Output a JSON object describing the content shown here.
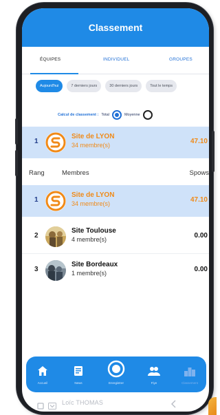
{
  "header": {
    "title": "Classement"
  },
  "tabs": [
    {
      "label": "ÉQUIPES"
    },
    {
      "label": "INDIVIDUEL"
    },
    {
      "label": "GROUPES"
    }
  ],
  "periods": [
    {
      "label": "Aujourd'hui",
      "active": true
    },
    {
      "label": "7 derniers jours",
      "active": false
    },
    {
      "label": "30 derniers jours",
      "active": false
    },
    {
      "label": "Tout le temps",
      "active": false
    }
  ],
  "calc": {
    "label": "Calcul de classement :",
    "option_total": "Total",
    "option_average": "Moyenne",
    "selected": "Total"
  },
  "my_team": {
    "rank": "1",
    "name": "Site de LYON",
    "members": "34 membre(s)",
    "score": "47.10"
  },
  "columns": {
    "rank": "Rang",
    "members": "Membres",
    "score": "Spows"
  },
  "rows": [
    {
      "rank": "1",
      "name": "Site de LYON",
      "members": "34 membre(s)",
      "score": "47.10"
    },
    {
      "rank": "2",
      "name": "Site Toulouse",
      "members": "4 membre(s)",
      "score": "0.00"
    },
    {
      "rank": "3",
      "name": "Site Bordeaux",
      "members": "1 membre(s)",
      "score": "0.00"
    }
  ],
  "nav": [
    {
      "label": "Accueil",
      "icon": "home-icon"
    },
    {
      "label": "News",
      "icon": "news-icon"
    },
    {
      "label": "Enregistrer",
      "icon": "record-icon"
    },
    {
      "label": "Fiye",
      "icon": "users-icon"
    },
    {
      "label": "Classement",
      "icon": "ranking-icon"
    }
  ],
  "android_bar": {
    "text": "Loïc THOMAS"
  },
  "colors": {
    "primary": "#1f8ae6",
    "highlight": "#cfe2f9",
    "accent": "#f08a18"
  }
}
